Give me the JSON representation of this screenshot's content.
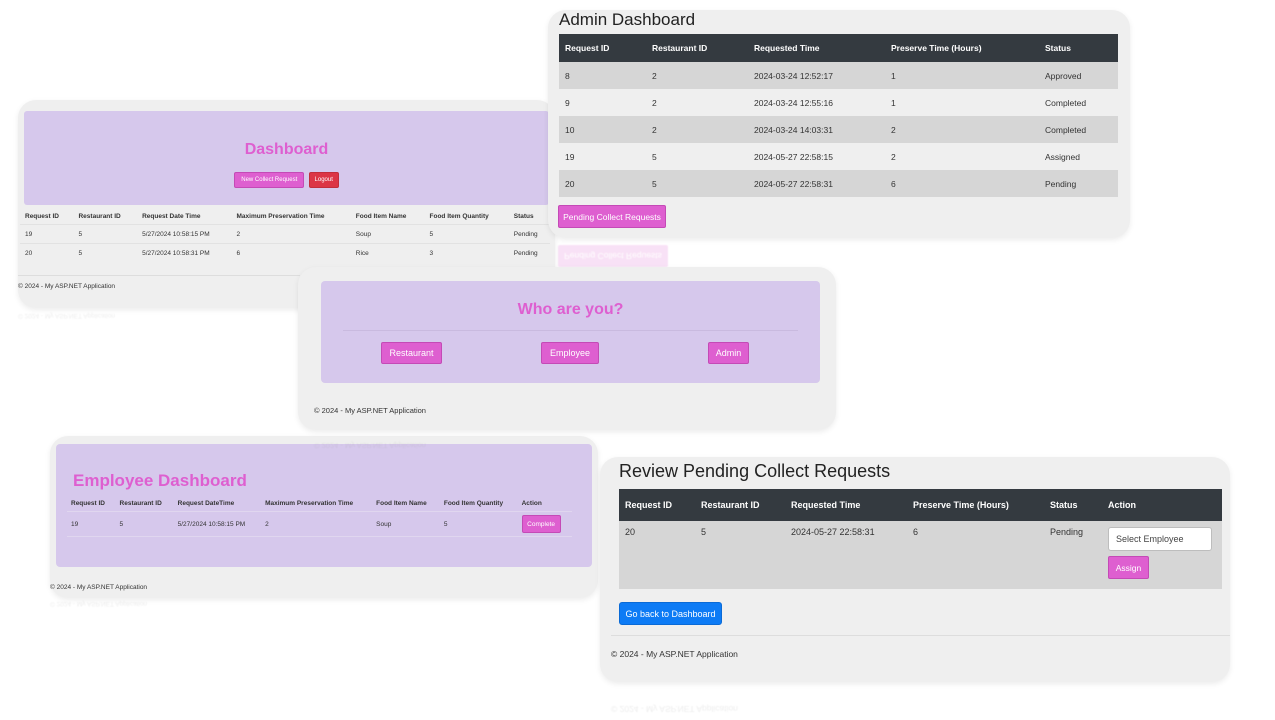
{
  "dashboard": {
    "title": "Dashboard",
    "new_request_label": "New Collect Request",
    "logout_label": "Logout",
    "columns": [
      "Request ID",
      "Restaurant ID",
      "Request Date Time",
      "Maximum Preservation Time",
      "Food Item Name",
      "Food Item Quantity",
      "Status"
    ],
    "rows": [
      [
        "19",
        "5",
        "5/27/2024 10:58:15 PM",
        "2",
        "Soup",
        "5",
        "Pending"
      ],
      [
        "20",
        "5",
        "5/27/2024 10:58:31 PM",
        "6",
        "Rice",
        "3",
        "Pending"
      ]
    ],
    "footer": "© 2024 - My ASP.NET Application"
  },
  "admin": {
    "title": "Admin Dashboard",
    "columns": [
      "Request ID",
      "Restaurant ID",
      "Requested Time",
      "Preserve Time (Hours)",
      "Status"
    ],
    "rows": [
      [
        "8",
        "2",
        "2024-03-24 12:52:17",
        "1",
        "Approved"
      ],
      [
        "9",
        "2",
        "2024-03-24 12:55:16",
        "1",
        "Completed"
      ],
      [
        "10",
        "2",
        "2024-03-24 14:03:31",
        "2",
        "Completed"
      ],
      [
        "19",
        "5",
        "2024-05-27 22:58:15",
        "2",
        "Assigned"
      ],
      [
        "20",
        "5",
        "2024-05-27 22:58:31",
        "6",
        "Pending"
      ]
    ],
    "pending_button_label": "Pending Collect Requests"
  },
  "who": {
    "title": "Who are you?",
    "restaurant_label": "Restaurant",
    "employee_label": "Employee",
    "admin_label": "Admin",
    "footer": "© 2024 - My ASP.NET Application"
  },
  "employee": {
    "title": "Employee Dashboard",
    "columns": [
      "Request ID",
      "Restaurant ID",
      "Request DateTime",
      "Maximum Preservation Time",
      "Food Item Name",
      "Food Item Quantity",
      "Action"
    ],
    "rows": [
      [
        "19",
        "5",
        "5/27/2024 10:58:15 PM",
        "2",
        "Soup",
        "5"
      ]
    ],
    "complete_label": "Complete",
    "footer": "© 2024 - My ASP.NET Application"
  },
  "review": {
    "title": "Review Pending Collect Requests",
    "columns": [
      "Request ID",
      "Restaurant ID",
      "Requested Time",
      "Preserve Time (Hours)",
      "Status",
      "Action"
    ],
    "rows": [
      [
        "20",
        "5",
        "2024-05-27 22:58:31",
        "6",
        "Pending"
      ]
    ],
    "select_placeholder": "Select Employee",
    "assign_label": "Assign",
    "back_label": "Go back to Dashboard",
    "footer": "© 2024 - My ASP.NET Application"
  },
  "colors": {
    "accent_pink": "#de5fd0",
    "banner_purple": "#d6c8ec",
    "logout_red": "#dc3545",
    "header_dark": "#343a40",
    "back_blue": "#0d7bf5"
  }
}
